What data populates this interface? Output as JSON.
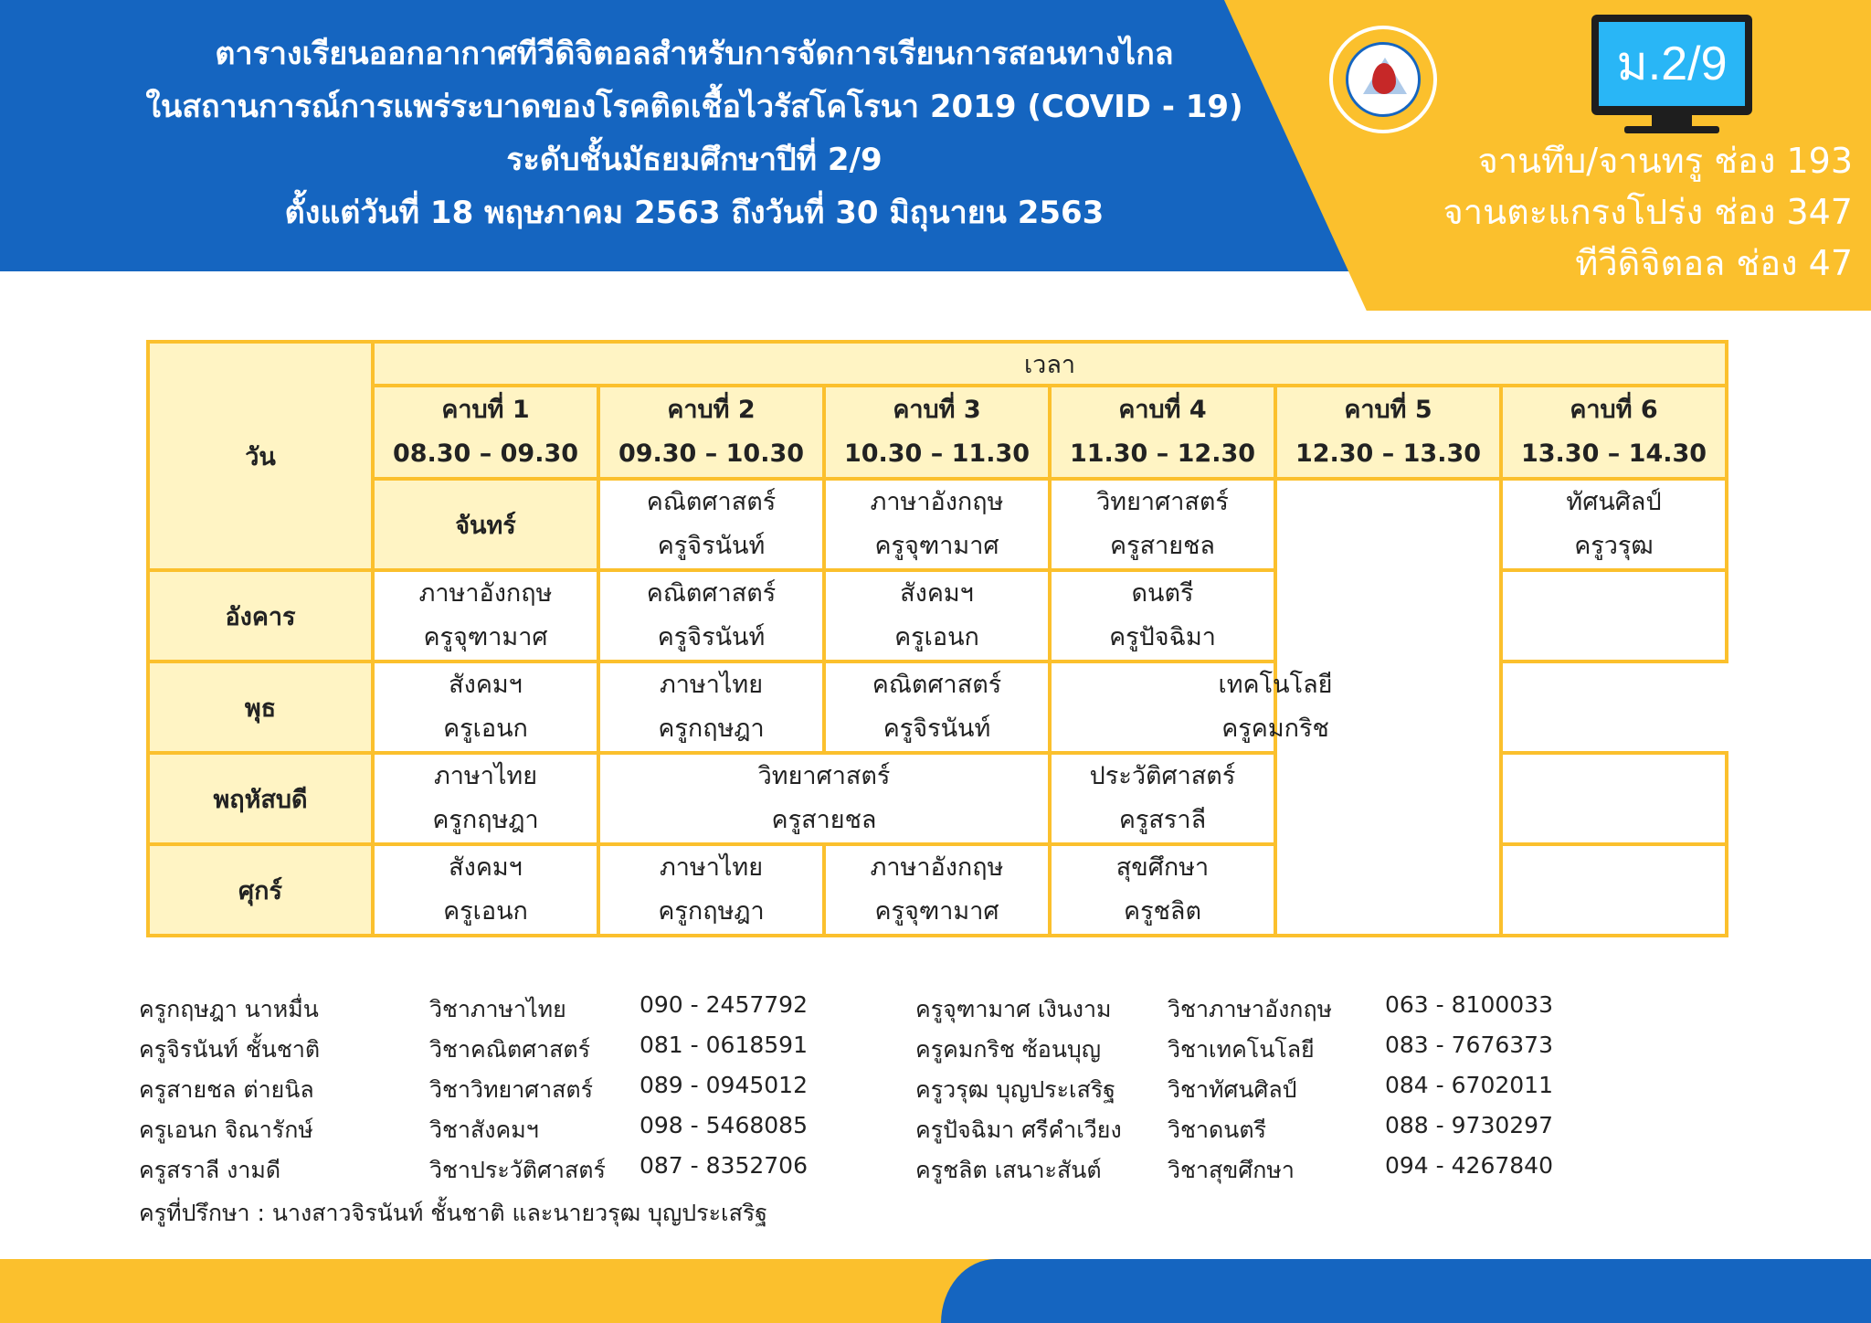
{
  "header": {
    "title_lines": [
      "ตารางเรียนออกอากาศทีวีดิจิตอลสำหรับการจัดการเรียนการสอนทางไกล",
      "ในสถานการณ์การแพร่ระบาดของโรคติดเชื้อไวรัสโคโรนา 2019 (COVID - 19)",
      "ระดับชั้นมัธยมศึกษาปีที่ 2/9",
      "ตั้งแต่วันที่ 18 พฤษภาคม 2563 ถึงวันที่ 30 มิถุนายน 2563"
    ],
    "class_badge": "ม.2/9",
    "channels": [
      "จานทึบ/จานทรู ช่อง 193",
      "จานตะแกรงโปร่ง ช่อง 347",
      "ทีวีดิจิตอล ช่อง 47"
    ]
  },
  "colors": {
    "blue": "#1565c0",
    "yellow": "#fbc02d",
    "header_cell": "#fff4c4"
  },
  "schedule": {
    "day_header": "วัน",
    "time_header": "เวลา",
    "periods": [
      {
        "label": "คาบที่ 1",
        "time": "08.30 – 09.30"
      },
      {
        "label": "คาบที่ 2",
        "time": "09.30 – 10.30"
      },
      {
        "label": "คาบที่ 3",
        "time": "10.30 – 11.30"
      },
      {
        "label": "คาบที่ 4",
        "time": "11.30 – 12.30"
      },
      {
        "label": "คาบที่ 5",
        "time": "12.30 – 13.30"
      },
      {
        "label": "คาบที่ 6",
        "time": "13.30 – 14.30"
      }
    ],
    "days": {
      "mon": {
        "name": "จันทร์",
        "p1": {
          "subject": "คณิตศาสตร์",
          "teacher": "ครูจิรนันท์"
        },
        "p2": {
          "subject": "ภาษาอังกฤษ",
          "teacher": "ครูจุฑามาศ"
        },
        "p3": {
          "subject": "วิทยาศาสตร์",
          "teacher": "ครูสายชล"
        },
        "p5": {
          "subject": "ทัศนศิลป์",
          "teacher": "ครูวรุฒ"
        }
      },
      "tue": {
        "name": "อังคาร",
        "p1": {
          "subject": "ภาษาอังกฤษ",
          "teacher": "ครูจุฑามาศ"
        },
        "p2": {
          "subject": "คณิตศาสตร์",
          "teacher": "ครูจิรนันท์"
        },
        "p3": {
          "subject": "สังคมฯ",
          "teacher": "ครูเอนก"
        },
        "p5": {
          "subject": "ดนตรี",
          "teacher": "ครูปัจฉิมา"
        }
      },
      "wed": {
        "name": "พุธ",
        "p1": {
          "subject": "สังคมฯ",
          "teacher": "ครูเอนก"
        },
        "p2": {
          "subject": "ภาษาไทย",
          "teacher": "ครูกฤษฎา"
        },
        "p3": {
          "subject": "คณิตศาสตร์",
          "teacher": "ครูจิรนันท์"
        },
        "p56": {
          "subject": "เทคโนโลยี",
          "teacher": "ครูคมกริช"
        }
      },
      "thu": {
        "name": "พฤหัสบดี",
        "p1": {
          "subject": "ภาษาไทย",
          "teacher": "ครูกฤษฎา"
        },
        "p23": {
          "subject": "วิทยาศาสตร์",
          "teacher": "ครูสายชล"
        },
        "p5": {
          "subject": "ประวัติศาสตร์",
          "teacher": "ครูสราลี"
        }
      },
      "fri": {
        "name": "ศุกร์",
        "p1": {
          "subject": "สังคมฯ",
          "teacher": "ครูเอนก"
        },
        "p2": {
          "subject": "ภาษาไทย",
          "teacher": "ครูกฤษฎา"
        },
        "p3": {
          "subject": "ภาษาอังกฤษ",
          "teacher": "ครูจุฑามาศ"
        },
        "p5": {
          "subject": "สุขศึกษา",
          "teacher": "ครูชลิต"
        }
      }
    }
  },
  "teachers": [
    {
      "name": "ครูกฤษฎา  นาหมื่น",
      "subject": "วิชาภาษาไทย",
      "phone": "090 - 2457792"
    },
    {
      "name": "ครูจิรนันท์  ชั้นชาติ",
      "subject": "วิชาคณิตศาสตร์",
      "phone": "081 - 0618591"
    },
    {
      "name": "ครูสายชล  ต่ายนิล",
      "subject": "วิชาวิทยาศาสตร์",
      "phone": "089 - 0945012"
    },
    {
      "name": "ครูเอนก  จิณารักษ์",
      "subject": "วิชาสังคมฯ",
      "phone": "098 - 5468085"
    },
    {
      "name": "ครูสราลี  งามดี",
      "subject": "วิชาประวัติศาสตร์",
      "phone": "087 - 8352706"
    },
    {
      "name": "ครูจุฑามาศ เงินงาม",
      "subject": "วิชาภาษาอังกฤษ",
      "phone": "063 - 8100033"
    },
    {
      "name": "ครูคมกริช  ซ้อนบุญ",
      "subject": "วิชาเทคโนโลยี",
      "phone": "083 - 7676373"
    },
    {
      "name": "ครูวรุฒ  บุญประเสริฐ",
      "subject": "วิชาทัศนศิลป์",
      "phone": "084 - 6702011"
    },
    {
      "name": "ครูปัจฉิมา  ศรีคำเวียง",
      "subject": "วิชาดนตรี",
      "phone": "088 - 9730297"
    },
    {
      "name": "ครูชลิต เสนาะสันต์",
      "subject": "วิชาสุขศึกษา",
      "phone": "094 - 4267840"
    }
  ],
  "advisor": "ครูที่ปรึกษา  : นางสาวจิรนันท์  ชั้นชาติ และนายวรุฒ  บุญประเสริฐ"
}
